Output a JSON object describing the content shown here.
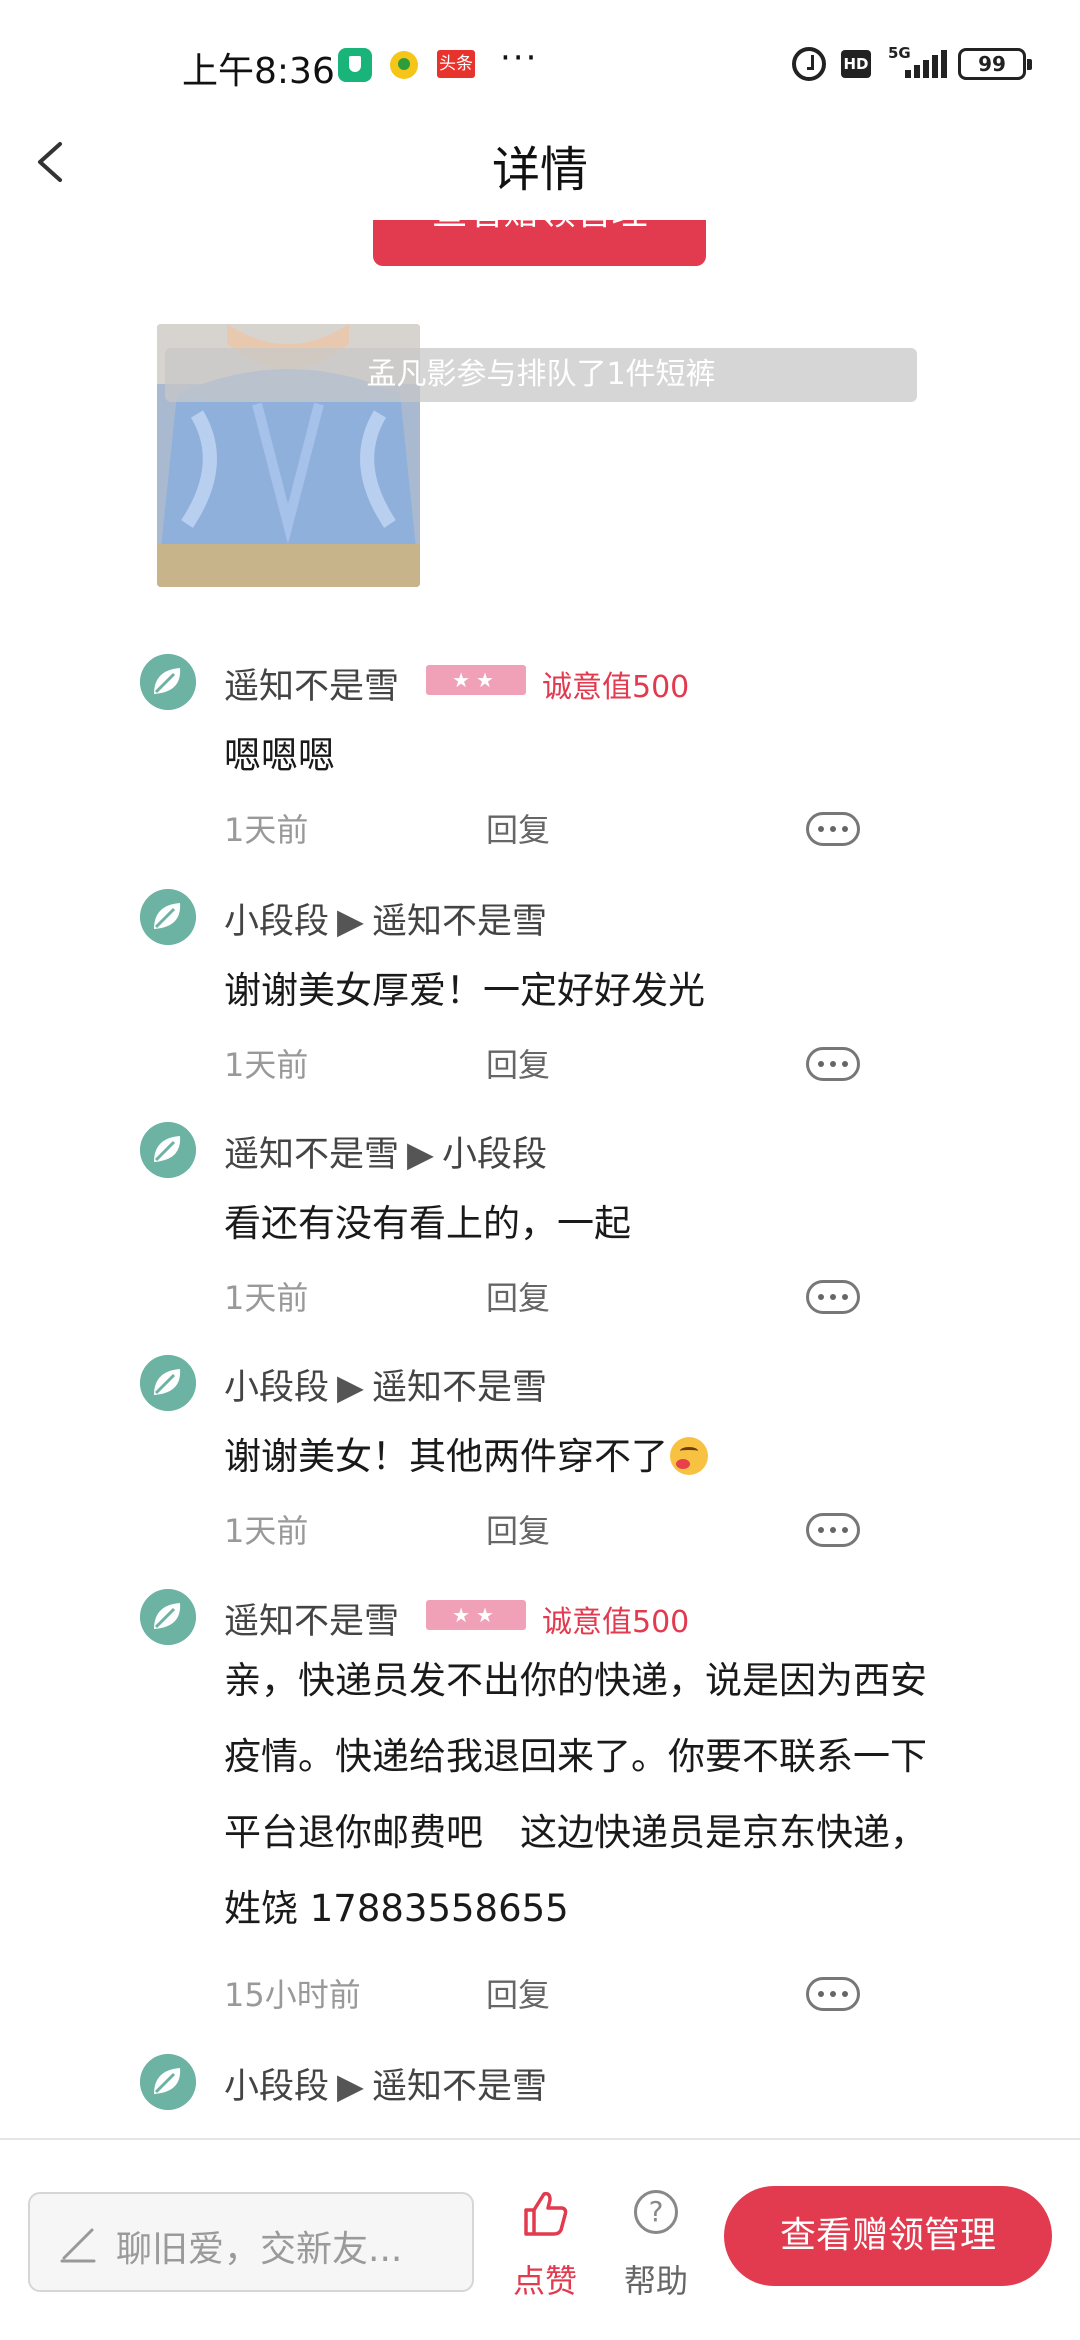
{
  "status_bar": {
    "time": "上午8:36",
    "toutiao_label": "头条",
    "more_dots": "···",
    "hd_label": "HD",
    "network_label": "5G",
    "battery": "99"
  },
  "header": {
    "title": "详情"
  },
  "top_button": {
    "label": "查看赠领管理"
  },
  "queue_notice": "孟凡影参与排队了1件短裤",
  "comments": [
    {
      "author": "遥知不是雪",
      "reply_to": "",
      "badge_stars": "★★",
      "sincerity": "诚意值500",
      "text": "嗯嗯嗯",
      "time": "1天前",
      "reply_label": "回复"
    },
    {
      "author": "小段段",
      "arrow": "▶",
      "reply_to": "遥知不是雪",
      "text": "谢谢美女厚爱！一定好好发光",
      "time": "1天前",
      "reply_label": "回复"
    },
    {
      "author": "遥知不是雪",
      "arrow": "▶",
      "reply_to": "小段段",
      "text": "看还有没有看上的，一起",
      "time": "1天前",
      "reply_label": "回复"
    },
    {
      "author": "小段段",
      "arrow": "▶",
      "reply_to": "遥知不是雪",
      "text": "谢谢美女！其他两件穿不了",
      "time": "1天前",
      "reply_label": "回复"
    },
    {
      "author": "遥知不是雪",
      "reply_to": "",
      "badge_stars": "★★",
      "sincerity": "诚意值500",
      "text_lines": [
        "亲，快递员发不出你的快递，说是因为西安",
        "疫情。快递给我退回来了。你要不联系一下",
        "平台退你邮费吧　这边快递员是京东快递，",
        "姓饶 17883558655"
      ],
      "time": "15小时前",
      "reply_label": "回复"
    },
    {
      "author": "小段段",
      "arrow": "▶",
      "reply_to": "遥知不是雪"
    }
  ],
  "bottom_bar": {
    "input_placeholder": "聊旧爱，交新友...",
    "like_label": "点赞",
    "help_label": "帮助",
    "help_symbol": "?",
    "primary_button": "查看赠领管理"
  },
  "colors": {
    "accent": "#e23a4e",
    "badge_pink": "#f0a1b8",
    "avatar_green": "#6cb3a3"
  }
}
